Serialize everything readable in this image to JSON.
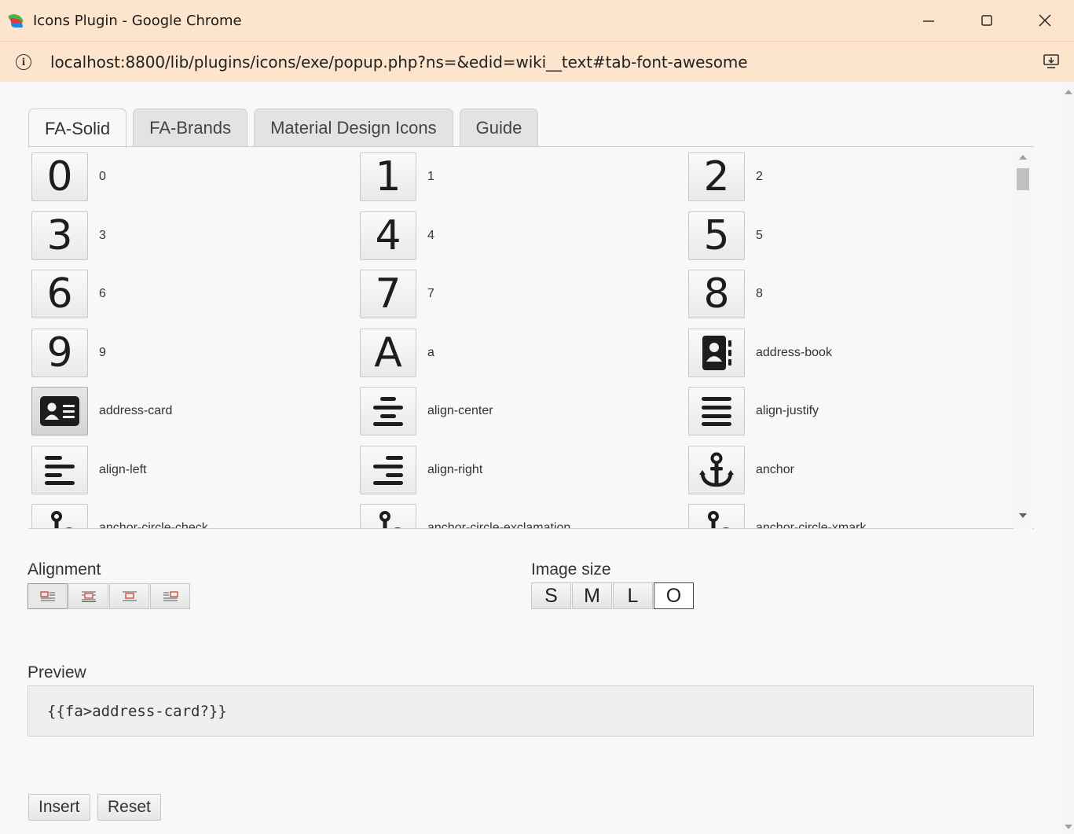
{
  "window": {
    "title": "Icons Plugin - Google Chrome",
    "url": "localhost:8800/lib/plugins/icons/exe/popup.php?ns=&edid=wiki__text#tab-font-awesome",
    "minimize_label": "—",
    "maximize_label": "☐",
    "close_label": "✕"
  },
  "tabs": [
    {
      "label": "FA-Solid",
      "active": true
    },
    {
      "label": "FA-Brands",
      "active": false
    },
    {
      "label": "Material Design Icons",
      "active": false
    },
    {
      "label": "Guide",
      "active": false
    }
  ],
  "icons": [
    {
      "glyph": "0",
      "label": "0"
    },
    {
      "glyph": "1",
      "label": "1"
    },
    {
      "glyph": "2",
      "label": "2"
    },
    {
      "glyph": "3",
      "label": "3"
    },
    {
      "glyph": "4",
      "label": "4"
    },
    {
      "glyph": "5",
      "label": "5"
    },
    {
      "glyph": "6",
      "label": "6"
    },
    {
      "glyph": "7",
      "label": "7"
    },
    {
      "glyph": "8",
      "label": "8"
    },
    {
      "glyph": "9",
      "label": "9"
    },
    {
      "glyph": "A",
      "label": "a"
    },
    {
      "icon": "address-book-icon",
      "label": "address-book"
    },
    {
      "icon": "address-card-icon",
      "label": "address-card",
      "selected": true
    },
    {
      "icon": "align-center-icon",
      "label": "align-center"
    },
    {
      "icon": "align-justify-icon",
      "label": "align-justify"
    },
    {
      "icon": "align-left-icon",
      "label": "align-left"
    },
    {
      "icon": "align-right-icon",
      "label": "align-right"
    },
    {
      "icon": "anchor-icon",
      "label": "anchor"
    },
    {
      "icon": "anchor-circle-check-icon",
      "label": "anchor-circle-check"
    },
    {
      "icon": "anchor-circle-exclamation-icon",
      "label": "anchor-circle-exclamation"
    },
    {
      "icon": "anchor-circle-xmark-icon",
      "label": "anchor-circle-xmark"
    }
  ],
  "alignment": {
    "label": "Alignment",
    "buttons": [
      {
        "icon": "align-left-image-icon",
        "active": true
      },
      {
        "icon": "align-center-image-icon",
        "active": false
      },
      {
        "icon": "align-none-image-icon",
        "active": false
      },
      {
        "icon": "align-right-image-icon",
        "active": false
      }
    ]
  },
  "image_size": {
    "label": "Image size",
    "buttons": [
      {
        "label": "S",
        "active": false
      },
      {
        "label": "M",
        "active": false
      },
      {
        "label": "L",
        "active": false
      },
      {
        "label": "O",
        "active": true
      }
    ]
  },
  "preview": {
    "label": "Preview",
    "value": "{{fa>address-card?}}"
  },
  "actions": {
    "insert_label": "Insert",
    "reset_label": "Reset"
  },
  "colors": {
    "chrome_bg": "#fce5cc",
    "icon_dark": "#1d1d1d",
    "align_icon_red": "#c0392b"
  }
}
